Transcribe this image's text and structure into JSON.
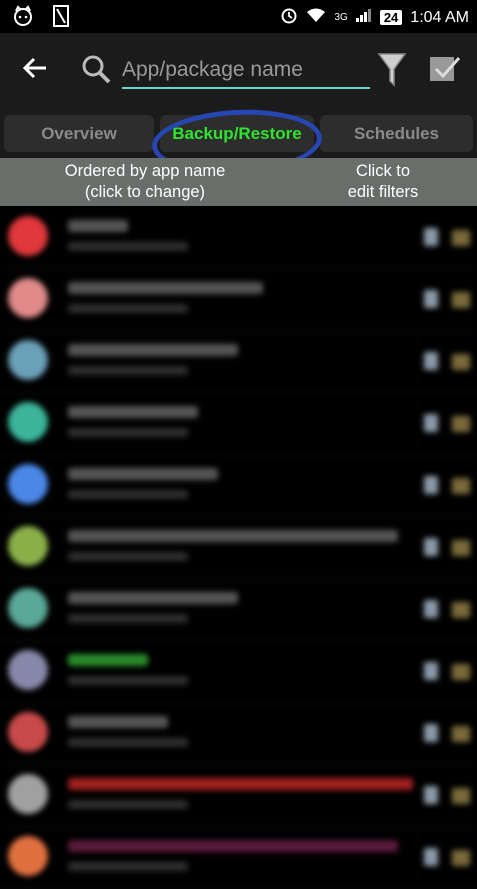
{
  "status_bar": {
    "time": "1:04 AM",
    "battery": "24",
    "network": "3G",
    "icons": [
      "cat-notification-icon",
      "file-notification-icon",
      "alarm-icon",
      "wifi-icon",
      "signal-icon"
    ]
  },
  "toolbar": {
    "back_icon": "back-arrow-icon",
    "search_placeholder": "App/package name",
    "search_value": "",
    "filter_icon": "funnel-icon",
    "select_icon": "checkbox-icon"
  },
  "tabs": [
    {
      "label": "Overview",
      "active": false
    },
    {
      "label": "Backup/Restore",
      "active": true
    },
    {
      "label": "Schedules",
      "active": false
    }
  ],
  "info_bar": {
    "order_text": "Ordered by app name\n(click to change)",
    "filter_text": "Click to\nedit filters"
  },
  "colors": {
    "active_tab": "#2fe32f",
    "search_underline": "#6fd3c2",
    "annotation_circle": "#2646b4",
    "info_bar_bg": "#6a6e6b"
  },
  "app_list": {
    "blurred": true,
    "rows": [
      {
        "icon_color": "#e0383c",
        "name_color": "#555555"
      },
      {
        "icon_color": "#e08a8a",
        "name_color": "#555555"
      },
      {
        "icon_color": "#6aa0b8",
        "name_color": "#555555"
      },
      {
        "icon_color": "#3bb49a",
        "name_color": "#555555"
      },
      {
        "icon_color": "#4a88e8",
        "name_color": "#555555"
      },
      {
        "icon_color": "#8ab04a",
        "name_color": "#555555"
      },
      {
        "icon_color": "#5aa898",
        "name_color": "#555555"
      },
      {
        "icon_color": "#8888aa",
        "name_color": "#2a8a2a"
      },
      {
        "icon_color": "#c84a4a",
        "name_color": "#555555"
      },
      {
        "icon_color": "#a0a0a0",
        "name_color": "#a02020"
      },
      {
        "icon_color": "#e07040",
        "name_color": "#5a1a3a"
      }
    ]
  }
}
